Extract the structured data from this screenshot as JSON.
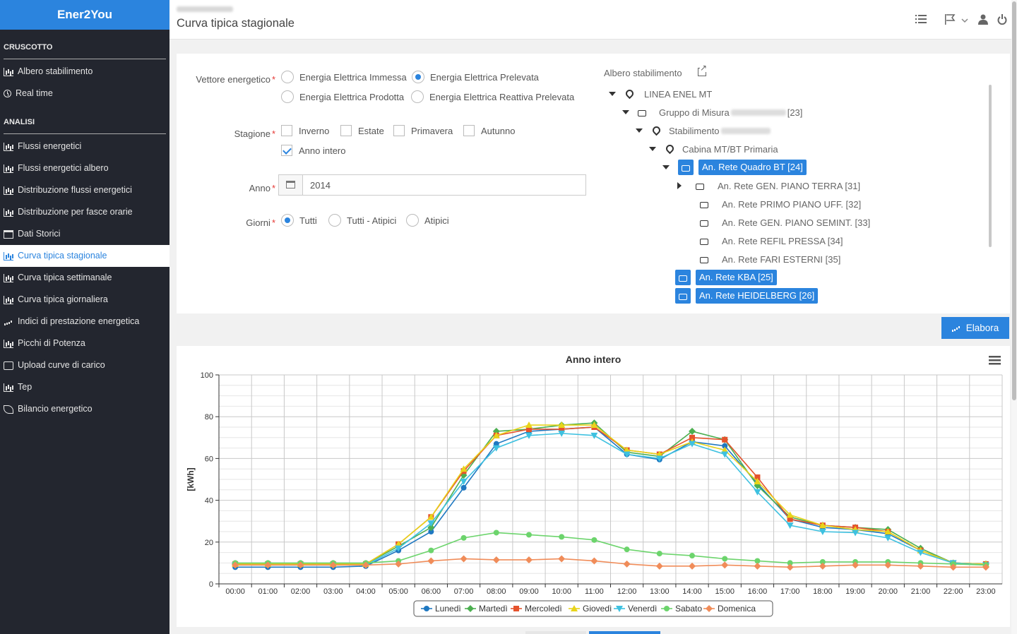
{
  "app": {
    "brand": "Ener2You"
  },
  "sidebar": {
    "sections": [
      {
        "title": "CRUSCOTTO",
        "items": [
          {
            "label": "Albero stabilimento",
            "icon": "bar-chart-icon"
          },
          {
            "label": "Real time",
            "icon": "clock-icon"
          }
        ]
      },
      {
        "title": "ANALISI",
        "items": [
          {
            "label": "Flussi energetici",
            "icon": "bar-chart-icon"
          },
          {
            "label": "Flussi energetici albero",
            "icon": "bar-chart-icon"
          },
          {
            "label": "Distribuzione flussi energetici",
            "icon": "bar-chart-icon"
          },
          {
            "label": "Distribuzione per fasce orarie",
            "icon": "bar-chart-icon"
          },
          {
            "label": "Dati Storici",
            "icon": "calendar-icon"
          },
          {
            "label": "Curva tipica stagionale",
            "icon": "bar-chart-icon",
            "active": true
          },
          {
            "label": "Curva tipica settimanale",
            "icon": "bar-chart-icon"
          },
          {
            "label": "Curva tipica giornaliera",
            "icon": "bar-chart-icon"
          },
          {
            "label": "Indici di prestazione energetica",
            "icon": "signal-icon"
          },
          {
            "label": "Picchi di Potenza",
            "icon": "bar-chart-icon"
          },
          {
            "label": "Upload curve di carico",
            "icon": "upload-icon"
          },
          {
            "label": "Tep",
            "icon": "bar-chart-icon"
          },
          {
            "label": "Bilancio energetico",
            "icon": "leaf-icon"
          }
        ]
      }
    ]
  },
  "header": {
    "title": "Curva tipica stagionale"
  },
  "form": {
    "vettore": {
      "label": "Vettore energetico",
      "required": "*",
      "options": [
        "Energia Elettrica Immessa",
        "Energia Elettrica Prelevata",
        "Energia Elettrica Prodotta",
        "Energia Elettrica Reattiva Prelevata"
      ],
      "selected": "Energia Elettrica Prelevata"
    },
    "stagione": {
      "label": "Stagione",
      "required": "*",
      "options": [
        "Inverno",
        "Estate",
        "Primavera",
        "Autunno",
        "Anno intero"
      ],
      "checked": [
        "Anno intero"
      ]
    },
    "anno": {
      "label": "Anno",
      "required": "*",
      "value": "2014"
    },
    "giorni": {
      "label": "Giorni",
      "required": "*",
      "options": [
        "Tutti",
        "Tutti - Atipici",
        "Atipici"
      ],
      "selected": "Tutti"
    }
  },
  "tree": {
    "title": "Albero stabilimento",
    "nodes": [
      {
        "label": "LINEA ENEL MT",
        "icon": "map-marker-icon"
      },
      {
        "label": "Gruppo di Misura",
        "suffix": "[23]",
        "icon": "inbox-icon"
      },
      {
        "label": "Stabilimento",
        "suffix": "",
        "icon": "map-marker-icon"
      },
      {
        "label": "Cabina MT/BT Primaria",
        "icon": "map-marker-icon"
      },
      {
        "label": "An. Rete Quadro BT [24]",
        "icon": "inbox-icon",
        "selected": true
      },
      {
        "label": "An. Rete GEN. PIANO TERRA [31]",
        "icon": "inbox-icon"
      },
      {
        "label": "An. Rete PRIMO PIANO UFF. [32]",
        "icon": "inbox-icon"
      },
      {
        "label": "An. Rete GEN. PIANO SEMINT. [33]",
        "icon": "inbox-icon"
      },
      {
        "label": "An. Rete REFIL PRESSA [34]",
        "icon": "inbox-icon"
      },
      {
        "label": "An. Rete FARI ESTERNI [35]",
        "icon": "inbox-icon"
      },
      {
        "label": "An. Rete KBA [25]",
        "icon": "inbox-icon",
        "selected": true
      },
      {
        "label": "An. Rete HEIDELBERG [26]",
        "icon": "inbox-icon",
        "selected": true
      }
    ]
  },
  "actions": {
    "elabora": "Elabora"
  },
  "chart_data": {
    "type": "line",
    "title": "Anno intero",
    "ylabel": "[kWh]",
    "xlabel": "",
    "ylim": [
      0,
      100
    ],
    "yticks": [
      0,
      20,
      40,
      60,
      80,
      100
    ],
    "grid": true,
    "legend": "bottom-center",
    "categories": [
      "00:00",
      "01:00",
      "02:00",
      "03:00",
      "04:00",
      "05:00",
      "06:00",
      "07:00",
      "08:00",
      "09:00",
      "10:00",
      "11:00",
      "12:00",
      "13:00",
      "14:00",
      "15:00",
      "16:00",
      "17:00",
      "18:00",
      "19:00",
      "20:00",
      "21:00",
      "22:00",
      "23:00"
    ],
    "series": [
      {
        "name": "Lunedì",
        "color": "#1f78c1",
        "marker": "circle",
        "values": [
          8,
          8,
          8,
          8,
          8.5,
          16,
          25,
          46,
          67,
          73,
          74,
          75,
          62,
          59.5,
          68,
          66,
          48,
          31,
          27,
          26,
          24,
          16,
          10,
          9.5
        ]
      },
      {
        "name": "Martedì",
        "color": "#4caf50",
        "marker": "diamond",
        "values": [
          9.5,
          9.5,
          9.5,
          9.5,
          9.5,
          18,
          27,
          52,
          73,
          74,
          76,
          77,
          63,
          61,
          73,
          69,
          47,
          32,
          28,
          27,
          26,
          17,
          10,
          9.5
        ]
      },
      {
        "name": "Mercoledì",
        "color": "#e5532d",
        "marker": "square",
        "values": [
          9.5,
          9.5,
          9.5,
          9.5,
          9.5,
          19,
          32,
          54,
          71,
          74,
          74,
          75,
          64,
          62,
          70,
          69,
          51,
          31,
          28,
          27,
          25,
          16,
          10,
          9.5
        ]
      },
      {
        "name": "Giovedì",
        "color": "#e8d41a",
        "marker": "triangle",
        "values": [
          9.5,
          9.5,
          9.5,
          9.5,
          9.5,
          19,
          32,
          55,
          71,
          76,
          76,
          76,
          64,
          62,
          68,
          64,
          49,
          33,
          28,
          26,
          25,
          16,
          10,
          9.5
        ]
      },
      {
        "name": "Venerdì",
        "color": "#3ec1e0",
        "marker": "triangle-down",
        "values": [
          9,
          9,
          9,
          9,
          9,
          17,
          29,
          49,
          65,
          71,
          72,
          71,
          62,
          60,
          67,
          62,
          44,
          28,
          25,
          24.5,
          22,
          15,
          10,
          9
        ]
      },
      {
        "name": "Sabato",
        "color": "#6cd46c",
        "marker": "circle",
        "values": [
          10,
          10,
          10,
          10,
          10,
          11,
          16,
          22,
          24.5,
          23.5,
          22.5,
          21,
          16.5,
          14.5,
          13.5,
          12,
          11,
          10,
          10.5,
          10.5,
          10.5,
          10,
          9.5,
          9
        ]
      },
      {
        "name": "Domenica",
        "color": "#f08c59",
        "marker": "diamond",
        "values": [
          9,
          9,
          9,
          9,
          9,
          9.5,
          11,
          12,
          11.5,
          11.5,
          12,
          11,
          9.5,
          8.5,
          8.5,
          9,
          8.5,
          8,
          8.5,
          9,
          9,
          8.5,
          8,
          8
        ]
      }
    ]
  }
}
